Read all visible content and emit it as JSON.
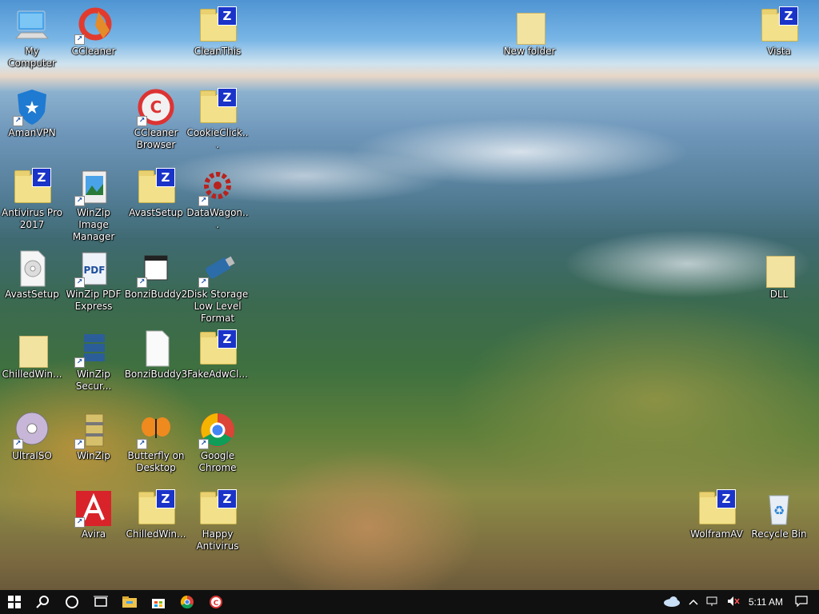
{
  "desktop_icons": [
    {
      "label": "My Computer",
      "kind": "computer",
      "shortcut": false
    },
    {
      "label": "CCleaner",
      "kind": "ccleaner",
      "shortcut": true
    },
    {
      "label": "CleanThis",
      "kind": "zfolder",
      "shortcut": false
    },
    {
      "label": "New folder",
      "kind": "plainfolder",
      "shortcut": false
    },
    {
      "label": "Vista",
      "kind": "zfolder",
      "shortcut": false
    },
    {
      "label": "AmanVPN",
      "kind": "shield",
      "shortcut": true
    },
    {
      "label": "CCleaner Browser",
      "kind": "ccbrowser",
      "shortcut": true
    },
    {
      "label": "CookieClick...",
      "kind": "zfolder",
      "shortcut": false
    },
    {
      "label": "Antivirus Pro 2017",
      "kind": "zfolder",
      "shortcut": false
    },
    {
      "label": "WinZip Image Manager",
      "kind": "winzipimg",
      "shortcut": true
    },
    {
      "label": "AvastSetup",
      "kind": "zfolder",
      "shortcut": false
    },
    {
      "label": "DataWagon...",
      "kind": "gear",
      "shortcut": true
    },
    {
      "label": "AvastSetup",
      "kind": "disc",
      "shortcut": false
    },
    {
      "label": "WinZip PDF Express",
      "kind": "pdf",
      "shortcut": true
    },
    {
      "label": "BonziBuddy2",
      "kind": "window",
      "shortcut": true
    },
    {
      "label": "Disk Storage Low Level Format",
      "kind": "usb",
      "shortcut": true
    },
    {
      "label": "DLL",
      "kind": "plainfolder",
      "shortcut": false
    },
    {
      "label": "ChilledWin...",
      "kind": "plainfolder",
      "shortcut": false
    },
    {
      "label": "WinZip Secur...",
      "kind": "server",
      "shortcut": true
    },
    {
      "label": "BonziBuddy3",
      "kind": "file",
      "shortcut": false
    },
    {
      "label": "FakeAdwCl...",
      "kind": "zfolder",
      "shortcut": false
    },
    {
      "label": "UltraISO",
      "kind": "cd",
      "shortcut": true
    },
    {
      "label": "WinZip",
      "kind": "winzip",
      "shortcut": true
    },
    {
      "label": "Butterfly on Desktop",
      "kind": "butterfly",
      "shortcut": true
    },
    {
      "label": "Google Chrome",
      "kind": "chrome",
      "shortcut": true
    },
    {
      "label": "Avira",
      "kind": "avira",
      "shortcut": true
    },
    {
      "label": "ChilledWin...",
      "kind": "zfolder",
      "shortcut": false
    },
    {
      "label": "Happy Antivirus",
      "kind": "zfolder",
      "shortcut": false
    },
    {
      "label": "WolframAV",
      "kind": "zfolder",
      "shortcut": false
    },
    {
      "label": "Recycle Bin",
      "kind": "recycle",
      "shortcut": false
    }
  ],
  "taskbar": {
    "start": "start-icon",
    "pinned": [
      "search-icon",
      "cortana-icon",
      "task-view-icon",
      "file-explorer-icon",
      "store-icon",
      "chrome-icon",
      "ccleaner-icon"
    ],
    "tray": [
      "onedrive-icon",
      "chevron-up-icon",
      "network-icon",
      "volume-muted-icon"
    ],
    "clock": "5:11 AM",
    "notification": "action-center-icon"
  }
}
